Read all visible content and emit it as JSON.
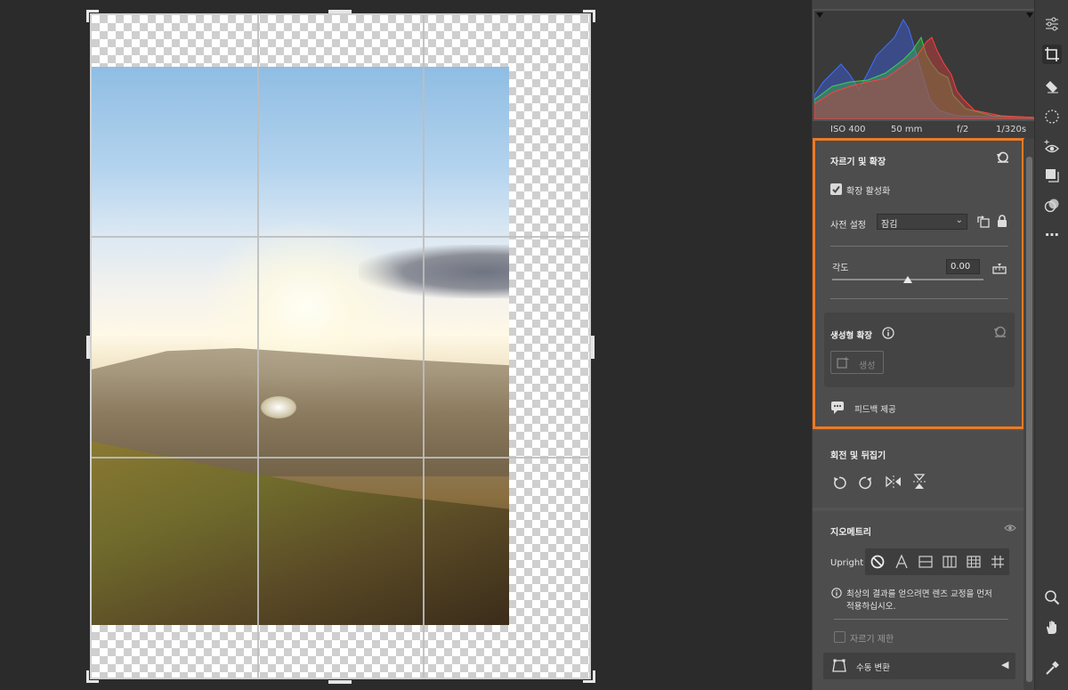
{
  "exif": {
    "iso": "ISO 400",
    "focal": "50 mm",
    "aperture": "f/2",
    "shutter": "1/320s"
  },
  "crop_section": {
    "title": "자르기 및 확장",
    "expand_checkbox_label": "확장 활성화",
    "expand_checked": true,
    "preset_label": "사전 설정",
    "preset_value": "잠김",
    "angle_label": "각도",
    "angle_value": "0.00",
    "angle_slider_fraction": 0.5
  },
  "generative_expand": {
    "title": "생성형 확장",
    "generate_label": "생성"
  },
  "feedback": {
    "label": "피드백 제공"
  },
  "rotate_section": {
    "title": "회전 및 뒤집기"
  },
  "geometry_section": {
    "title": "지오메트리",
    "upright_label": "Upright",
    "info_text_line1": "최상의 결과를 얻으려면 렌즈 교정을 먼저",
    "info_text_line2": "적용하십시오.",
    "constrain_crop_label": "자르기 제한",
    "manual_transform_label": "수동 변환"
  },
  "colors": {
    "highlight": "#ee7a24",
    "panel": "#535353",
    "canvas": "#2b2b2b"
  },
  "toolbar": {
    "tools": [
      "sliders-icon",
      "crop-icon",
      "eraser-icon",
      "heal-icon",
      "redeye-icon",
      "layers-icon",
      "presets-icon",
      "more-icon",
      "zoom-icon",
      "hand-icon",
      "eyedropper-icon"
    ],
    "active": "crop-icon"
  }
}
